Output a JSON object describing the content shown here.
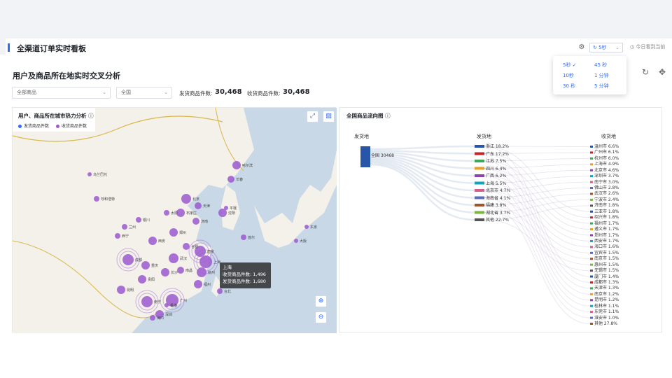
{
  "app": {
    "title": "全渠道订单实时看板"
  },
  "toolbar": {
    "refresh_value": "5秒",
    "today_label": "今日看到当前"
  },
  "refresh_menu": {
    "options": [
      "5秒",
      "10秒",
      "30 秒",
      "45 秒",
      "1 分钟",
      "5 分钟"
    ],
    "selected": "5秒",
    "check": "✓"
  },
  "section": {
    "title": "用户及商品所在地实时交叉分析"
  },
  "filters": {
    "product": "全部商品",
    "region": "全国"
  },
  "stats": {
    "ship_label": "发货商品件数:",
    "ship_value": "30,468",
    "receive_label": "收货商品件数:",
    "receive_value": "30,468"
  },
  "map": {
    "title": "用户、商品所在城市热力分析",
    "legend": [
      {
        "label": "发货商品件数",
        "color": "#2f6bff"
      },
      {
        "label": "收货商品件数",
        "color": "#9b59d0"
      }
    ],
    "bubble_color": "#9b59d0",
    "tooltip": {
      "city": "上海",
      "receive_label": "收货商品件数:",
      "receive_value": "1,496",
      "ship_label": "发货商品件数:",
      "ship_value": "1,680"
    },
    "labels": [
      "呼和浩特",
      "哈尔滨",
      "长春",
      "沈阳",
      "北京",
      "天津",
      "石家庄",
      "太原",
      "济南",
      "郑州",
      "西安",
      "兰州",
      "银川",
      "西宁",
      "成都",
      "重庆",
      "武汉",
      "南京",
      "上海",
      "杭州",
      "合肥",
      "长沙",
      "南昌",
      "福州",
      "台北",
      "广州",
      "深圳",
      "南宁",
      "贵阳",
      "昆明",
      "海口",
      "香港",
      "首尔",
      "东京",
      "大阪",
      "平壤",
      "乌兰巴托"
    ]
  },
  "flow": {
    "title": "全国商品流向图",
    "columns": [
      "发货地",
      "发货地",
      "收货地"
    ],
    "source": {
      "label": "全国 30468",
      "color": "#2756a8"
    },
    "provinces": [
      {
        "name": "浙江",
        "pct": "18.2%",
        "color": "#2756a8"
      },
      {
        "name": "广东",
        "pct": "17.2%",
        "color": "#c0262d"
      },
      {
        "name": "江苏",
        "pct": "7.5%",
        "color": "#3aa95d"
      },
      {
        "name": "四川",
        "pct": "6.4%",
        "color": "#e8a020"
      },
      {
        "name": "广西",
        "pct": "6.2%",
        "color": "#8e44ad"
      },
      {
        "name": "上海",
        "pct": "5.5%",
        "color": "#16a2b8"
      },
      {
        "name": "北京市",
        "pct": "4.7%",
        "color": "#d35f8a"
      },
      {
        "name": "海南省",
        "pct": "4.1%",
        "color": "#5c6bc0"
      },
      {
        "name": "福建",
        "pct": "3.8%",
        "color": "#a0522d"
      },
      {
        "name": "湖北省",
        "pct": "3.7%",
        "color": "#7cb342"
      },
      {
        "name": "其他",
        "pct": "22.7%",
        "color": "#555555"
      }
    ],
    "cities": [
      {
        "name": "温州市",
        "pct": "6.6%"
      },
      {
        "name": "广州市",
        "pct": "6.1%"
      },
      {
        "name": "杭州市",
        "pct": "6.0%"
      },
      {
        "name": "上海市",
        "pct": "4.9%"
      },
      {
        "name": "北京市",
        "pct": "4.6%"
      },
      {
        "name": "深圳市",
        "pct": "3.7%"
      },
      {
        "name": "南宁市",
        "pct": "3.0%"
      },
      {
        "name": "佛山市",
        "pct": "2.8%"
      },
      {
        "name": "武汉市",
        "pct": "2.6%"
      },
      {
        "name": "宁波市",
        "pct": "2.4%"
      },
      {
        "name": "济南市",
        "pct": "1.8%"
      },
      {
        "name": "三亚市",
        "pct": "1.8%"
      },
      {
        "name": "绍兴市",
        "pct": "1.8%"
      },
      {
        "name": "福州市",
        "pct": "1.7%"
      },
      {
        "name": "遵义市",
        "pct": "1.7%"
      },
      {
        "name": "郑州市",
        "pct": "1.7%"
      },
      {
        "name": "西安市",
        "pct": "1.7%"
      },
      {
        "name": "海口市",
        "pct": "1.6%"
      },
      {
        "name": "宜宾市",
        "pct": "1.5%"
      },
      {
        "name": "南京市",
        "pct": "1.5%"
      },
      {
        "name": "惠州市",
        "pct": "1.5%"
      },
      {
        "name": "无锡市",
        "pct": "1.5%"
      },
      {
        "name": "厦门市",
        "pct": "1.4%"
      },
      {
        "name": "成都市",
        "pct": "1.3%"
      },
      {
        "name": "天津市",
        "pct": "1.3%"
      },
      {
        "name": "南京市",
        "pct": "1.2%"
      },
      {
        "name": "昆明市",
        "pct": "1.2%"
      },
      {
        "name": "桂林市",
        "pct": "1.1%"
      },
      {
        "name": "东莞市",
        "pct": "1.1%"
      },
      {
        "name": "淮安市",
        "pct": "1.0%"
      },
      {
        "name": "其他",
        "pct": "27.8%"
      }
    ]
  }
}
